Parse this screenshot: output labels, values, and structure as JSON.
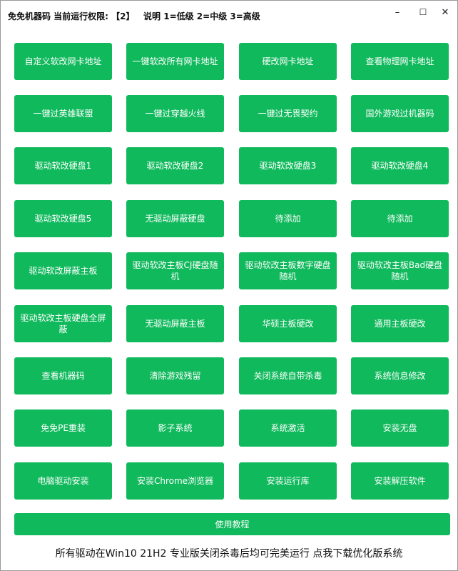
{
  "window": {
    "title": "免免机器码 当前运行权限: 【2】   说明 1=低级 2=中级 3=高级",
    "minimize_glyph": "–",
    "maximize_glyph": "☐",
    "close_glyph": "✕"
  },
  "buttons": [
    "自定义软改网卡地址",
    "一键软改所有网卡地址",
    "硬改网卡地址",
    "查看物理网卡地址",
    "一键过英雄联盟",
    "一键过穿越火线",
    "一键过无畏契约",
    "国外游戏过机器码",
    "驱动软改硬盘1",
    "驱动软改硬盘2",
    "驱动软改硬盘3",
    "驱动软改硬盘4",
    "驱动软改硬盘5",
    "无驱动屏蔽硬盘",
    "待添加",
    "待添加",
    "驱动软改屏蔽主板",
    "驱动软改主板CJ硬盘随机",
    "驱动软改主板数字硬盘随机",
    "驱动软改主板Bad硬盘随机",
    "驱动软改主板硬盘全屏蔽",
    "无驱动屏蔽主板",
    "华硕主板硬改",
    "通用主板硬改",
    "查看机器码",
    "清除游戏残留",
    "关闭系统自带杀毒",
    "系统信息修改",
    "免免PE重装",
    "影子系统",
    "系统激活",
    "安装无盘",
    "电脑驱动安装",
    "安装Chrome浏览器",
    "安装运行库",
    "安装解压软件"
  ],
  "tutorial_button": "使用教程",
  "footer_text": "所有驱动在Win10 21H2 专业版关闭杀毒后均可完美运行 点我下载优化版系统",
  "colors": {
    "button_green": "#10b95c",
    "button_text": "#ffffff",
    "background": "#ffffff"
  }
}
